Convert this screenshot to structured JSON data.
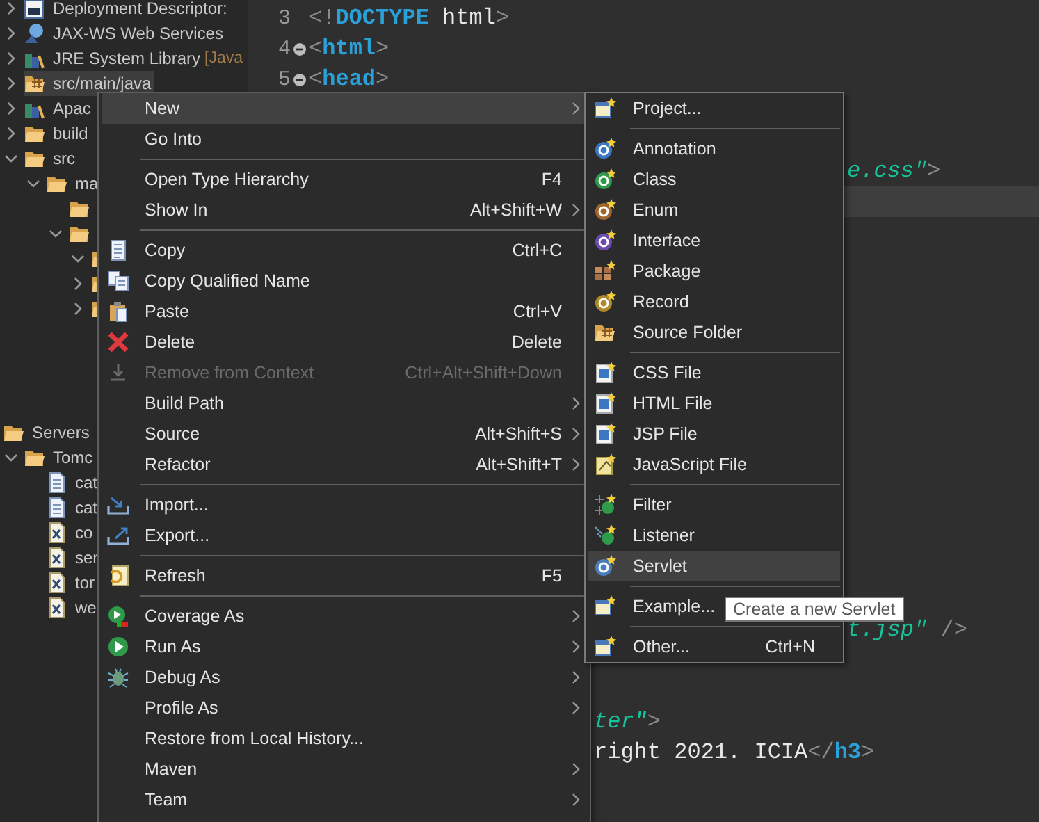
{
  "tree": {
    "items": [
      {
        "kind": "descriptor",
        "label": "Deployment Descriptor:",
        "expanded": false,
        "selected": false
      },
      {
        "kind": "services",
        "label": "JAX-WS Web Services",
        "expanded": false,
        "selected": false
      },
      {
        "kind": "library",
        "label": "JRE System Library",
        "decoration": "[Java",
        "expanded": false,
        "selected": false
      },
      {
        "kind": "source",
        "label": "src/main/java",
        "expanded": false,
        "selected": true
      },
      {
        "kind": "library",
        "label": "Apac",
        "expanded": false,
        "selected": false
      },
      {
        "kind": "folder",
        "label": "build",
        "expanded": false,
        "selected": false
      },
      {
        "kind": "folder",
        "label": "src",
        "expanded": true,
        "selected": false,
        "children": [
          {
            "kind": "folder",
            "label": "ma",
            "expanded": true,
            "selected": false,
            "children": [
              {
                "kind": "folder",
                "selected": false
              },
              {
                "kind": "folder",
                "expanded": true,
                "selected": false,
                "children": [
                  {
                    "kind": "folder",
                    "expanded": true,
                    "selected": false
                  },
                  {
                    "kind": "folder",
                    "expanded": false,
                    "selected": false
                  },
                  {
                    "kind": "folder",
                    "expanded": false,
                    "selected": false
                  }
                ]
              }
            ]
          }
        ]
      }
    ]
  },
  "servers": {
    "label": "Servers",
    "children": [
      {
        "kind": "folder",
        "label": "Tomc",
        "expanded": true,
        "selected": false,
        "children": [
          {
            "kind": "file",
            "label": "cat",
            "selected": false
          },
          {
            "kind": "file",
            "label": "cat",
            "selected": false
          },
          {
            "kind": "xml",
            "label": "co",
            "selected": false
          },
          {
            "kind": "xml",
            "label": "ser",
            "selected": false
          },
          {
            "kind": "xml",
            "label": "tor",
            "selected": false
          },
          {
            "kind": "xml",
            "label": "we",
            "selected": false
          }
        ]
      }
    ]
  },
  "editor": {
    "lines": [
      {
        "number": "3",
        "fold": false,
        "segments": [
          {
            "kind": "punct",
            "text": "<!"
          },
          {
            "kind": "tag",
            "text": "DOCTYPE"
          },
          {
            "kind": "text",
            "text": " html"
          },
          {
            "kind": "punct",
            "text": ">"
          }
        ]
      },
      {
        "number": "4",
        "fold": true,
        "segments": [
          {
            "kind": "punct",
            "text": "<"
          },
          {
            "kind": "tag",
            "text": "html"
          },
          {
            "kind": "punct",
            "text": ">"
          }
        ]
      },
      {
        "number": "5",
        "fold": true,
        "segments": [
          {
            "kind": "punct",
            "text": "<"
          },
          {
            "kind": "tag",
            "text": "head"
          },
          {
            "kind": "punct",
            "text": ">"
          }
        ]
      },
      {
        "segments": [
          {
            "kind": "string",
            "text": "e.css\""
          },
          {
            "kind": "punct",
            "text": ">"
          }
        ]
      },
      {
        "current": true
      },
      {
        "segments": [
          {
            "kind": "string",
            "text": "t.jsp\""
          },
          {
            "kind": "punct",
            "text": " />"
          }
        ]
      },
      {
        "segments": [
          {
            "kind": "string",
            "text": "ter\""
          },
          {
            "kind": "punct",
            "text": ">"
          }
        ]
      },
      {
        "segments": [
          {
            "kind": "text",
            "text": "right 2021. ICIA"
          },
          {
            "kind": "punct",
            "text": "</"
          },
          {
            "kind": "tag",
            "text": "h3"
          },
          {
            "kind": "punct",
            "text": ">"
          }
        ]
      }
    ]
  },
  "context_menu": {
    "items": [
      {
        "kind": "item",
        "label": "New",
        "submenu": true,
        "selected": true,
        "disabled": false
      },
      {
        "kind": "item",
        "label": "Go Into",
        "submenu": false,
        "selected": false,
        "disabled": false
      },
      {
        "kind": "separator"
      },
      {
        "kind": "item",
        "label": "Open Type Hierarchy",
        "shortcut": "F4",
        "submenu": false,
        "selected": false,
        "disabled": false
      },
      {
        "kind": "item",
        "label": "Show In",
        "shortcut": "Alt+Shift+W",
        "submenu": true,
        "selected": false,
        "disabled": false
      },
      {
        "kind": "separator"
      },
      {
        "kind": "item",
        "label": "Copy",
        "shortcut": "Ctrl+C",
        "submenu": false,
        "selected": false,
        "disabled": false
      },
      {
        "kind": "item",
        "label": "Copy Qualified Name",
        "submenu": false,
        "selected": false,
        "disabled": false
      },
      {
        "kind": "item",
        "label": "Paste",
        "shortcut": "Ctrl+V",
        "submenu": false,
        "selected": false,
        "disabled": false
      },
      {
        "kind": "item",
        "label": "Delete",
        "shortcut": "Delete",
        "submenu": false,
        "selected": false,
        "disabled": false
      },
      {
        "kind": "item",
        "label": "Remove from Context",
        "shortcut": "Ctrl+Alt+Shift+Down",
        "submenu": false,
        "selected": false,
        "disabled": true
      },
      {
        "kind": "item",
        "label": "Build Path",
        "submenu": true,
        "selected": false,
        "disabled": false
      },
      {
        "kind": "item",
        "label": "Source",
        "shortcut": "Alt+Shift+S",
        "submenu": true,
        "selected": false,
        "disabled": false
      },
      {
        "kind": "item",
        "label": "Refactor",
        "shortcut": "Alt+Shift+T",
        "submenu": true,
        "selected": false,
        "disabled": false
      },
      {
        "kind": "separator"
      },
      {
        "kind": "item",
        "label": "Import...",
        "submenu": false,
        "selected": false,
        "disabled": false
      },
      {
        "kind": "item",
        "label": "Export...",
        "submenu": false,
        "selected": false,
        "disabled": false
      },
      {
        "kind": "separator"
      },
      {
        "kind": "item",
        "label": "Refresh",
        "shortcut": "F5",
        "submenu": false,
        "selected": false,
        "disabled": false
      },
      {
        "kind": "separator"
      },
      {
        "kind": "item",
        "label": "Coverage As",
        "submenu": true,
        "selected": false,
        "disabled": false
      },
      {
        "kind": "item",
        "label": "Run As",
        "submenu": true,
        "selected": false,
        "disabled": false
      },
      {
        "kind": "item",
        "label": "Debug As",
        "submenu": true,
        "selected": false,
        "disabled": false
      },
      {
        "kind": "item",
        "label": "Profile As",
        "submenu": true,
        "selected": false,
        "disabled": false
      },
      {
        "kind": "item",
        "label": "Restore from Local History...",
        "submenu": false,
        "selected": false,
        "disabled": false
      },
      {
        "kind": "item",
        "label": "Maven",
        "submenu": true,
        "selected": false,
        "disabled": false
      },
      {
        "kind": "item",
        "label": "Team",
        "submenu": true,
        "selected": false,
        "disabled": false
      }
    ]
  },
  "new_submenu": {
    "items": [
      {
        "kind": "item",
        "label": "Project...",
        "selected": false
      },
      {
        "kind": "separator"
      },
      {
        "kind": "item",
        "label": "Annotation",
        "selected": false
      },
      {
        "kind": "item",
        "label": "Class",
        "selected": false
      },
      {
        "kind": "item",
        "label": "Enum",
        "selected": false
      },
      {
        "kind": "item",
        "label": "Interface",
        "selected": false
      },
      {
        "kind": "item",
        "label": "Package",
        "selected": false
      },
      {
        "kind": "item",
        "label": "Record",
        "selected": false
      },
      {
        "kind": "item",
        "label": "Source Folder",
        "selected": false
      },
      {
        "kind": "separator"
      },
      {
        "kind": "item",
        "label": "CSS File",
        "selected": false
      },
      {
        "kind": "item",
        "label": "HTML File",
        "selected": false
      },
      {
        "kind": "item",
        "label": "JSP File",
        "selected": false
      },
      {
        "kind": "item",
        "label": "JavaScript File",
        "selected": false
      },
      {
        "kind": "separator"
      },
      {
        "kind": "item",
        "label": "Filter",
        "selected": false
      },
      {
        "kind": "item",
        "label": "Listener",
        "selected": false
      },
      {
        "kind": "item",
        "label": "Servlet",
        "selected": true
      },
      {
        "kind": "separator"
      },
      {
        "kind": "item",
        "label": "Example...",
        "selected": false
      },
      {
        "kind": "separator"
      },
      {
        "kind": "item",
        "label": "Other...",
        "shortcut": "Ctrl+N",
        "selected": false
      }
    ]
  },
  "tooltip": {
    "text": "Create a new Servlet"
  }
}
